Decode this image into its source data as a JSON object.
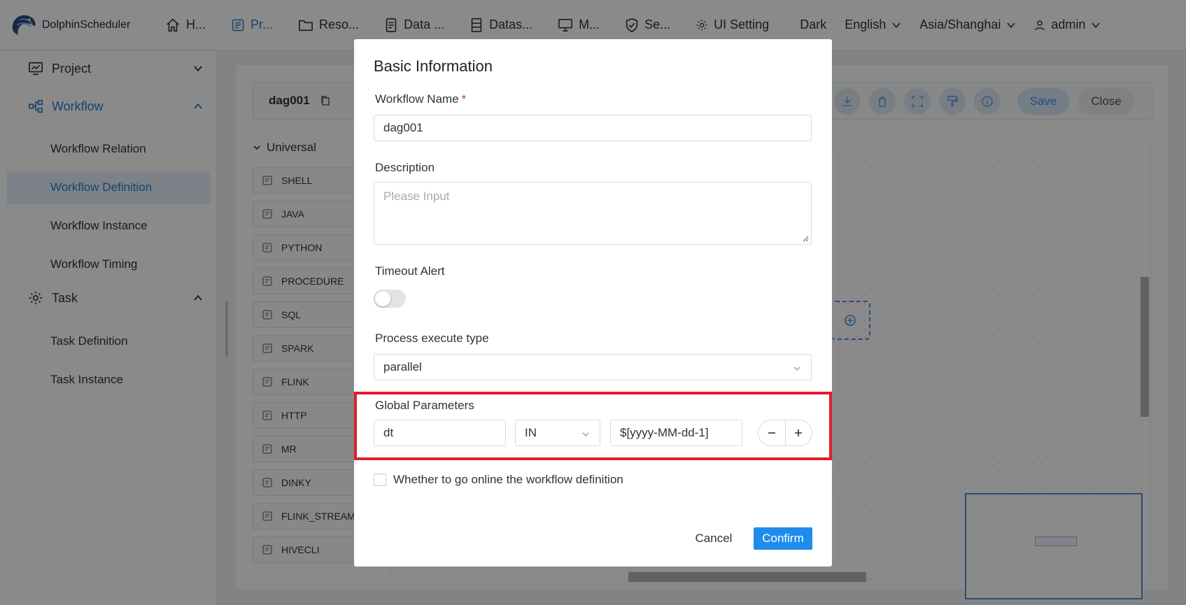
{
  "app": {
    "logo_text": "DolphinScheduler",
    "logo_icon": "dolphin-logo"
  },
  "nav": {
    "items": [
      {
        "label": "H...",
        "icon": "home-icon"
      },
      {
        "label": "Pr...",
        "icon": "project-icon",
        "active": true
      },
      {
        "label": "Reso...",
        "icon": "folder-icon"
      },
      {
        "label": "Data ...",
        "icon": "data-quality-icon"
      },
      {
        "label": "Datas...",
        "icon": "datasource-icon"
      },
      {
        "label": "M...",
        "icon": "monitor-icon"
      },
      {
        "label": "Se...",
        "icon": "shield-icon"
      },
      {
        "label": "UI Setting",
        "icon": "gear-icon"
      }
    ],
    "theme": "Dark",
    "language": "English",
    "timezone": "Asia/Shanghai",
    "user": "admin"
  },
  "sidebar": {
    "groups": [
      {
        "label": "Project",
        "icon": "project-chart-icon"
      },
      {
        "label": "Workflow",
        "icon": "workflow-icon"
      },
      {
        "label": "Task",
        "icon": "gear-icon"
      }
    ],
    "workflow_items": [
      "Workflow Relation",
      "Workflow Definition",
      "Workflow Instance",
      "Workflow Timing"
    ],
    "task_items": [
      "Task Definition",
      "Task Instance"
    ]
  },
  "workspace": {
    "dag_name": "dag001",
    "save_label": "Save",
    "close_label": "Close",
    "palette_title": "Universal",
    "palette": [
      "SHELL",
      "JAVA",
      "PYTHON",
      "PROCEDURE",
      "SQL",
      "SPARK",
      "FLINK",
      "HTTP",
      "MR",
      "DINKY",
      "FLINK_STREAM",
      "HIVECLI"
    ]
  },
  "modal": {
    "title": "Basic Information",
    "workflow_name_label": "Workflow Name",
    "required_mark": "*",
    "workflow_name_value": "dag001",
    "description_label": "Description",
    "description_placeholder": "Please Input",
    "timeout_label": "Timeout Alert",
    "timeout_enabled": false,
    "exec_type_label": "Process execute type",
    "exec_type_value": "parallel",
    "global_params_label": "Global Parameters",
    "global_params": {
      "key": "dt",
      "direction": "IN",
      "value": "$[yyyy-MM-dd-1]"
    },
    "online_label": "Whether to go online the workflow definition",
    "online_checked": false,
    "cancel_label": "Cancel",
    "confirm_label": "Confirm"
  },
  "colors": {
    "accent": "#2a7dc9",
    "confirm": "#1f8ceb",
    "highlight": "#e01e2d"
  }
}
